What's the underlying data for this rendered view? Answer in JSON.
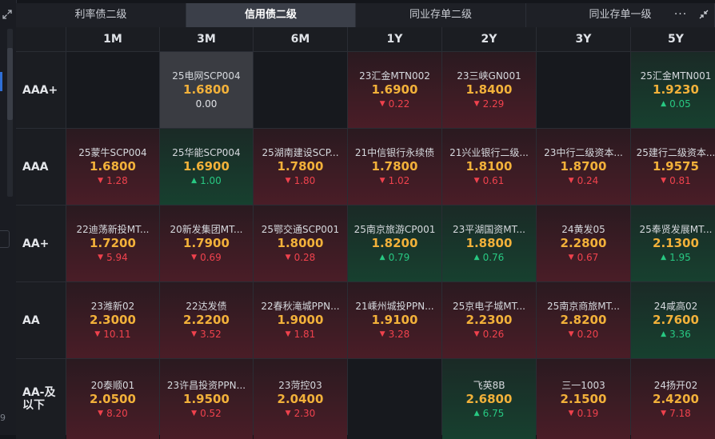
{
  "sidebar": {
    "bottom_number": "9"
  },
  "tabs": [
    {
      "label": "利率债二级",
      "active": false,
      "width": 213
    },
    {
      "label": "信用债二级",
      "active": true,
      "width": 212
    },
    {
      "label": "同业存单二级",
      "active": false,
      "width": 213
    },
    {
      "label": "同业存单一级",
      "active": false,
      "width": 236
    }
  ],
  "more_label": "···",
  "columns": [
    "1M",
    "3M",
    "6M",
    "1Y",
    "2Y",
    "3Y",
    "5Y"
  ],
  "rows": [
    {
      "label": "AAA+",
      "cells": [
        null,
        {
          "name": "25电网SCP004",
          "rate": "1.6800",
          "change": "0.00",
          "dir": "flat",
          "bg": "neutral"
        },
        null,
        {
          "name": "23汇金MTN002",
          "rate": "1.6900",
          "change": "0.22",
          "dir": "down",
          "bg": "red"
        },
        {
          "name": "23三峡GN001",
          "rate": "1.8400",
          "change": "2.29",
          "dir": "down",
          "bg": "red"
        },
        null,
        {
          "name": "25汇金MTN001",
          "rate": "1.9230",
          "change": "0.05",
          "dir": "up",
          "bg": "green"
        }
      ]
    },
    {
      "label": "AAA",
      "cells": [
        {
          "name": "25蒙牛SCP004",
          "rate": "1.6800",
          "change": "1.28",
          "dir": "down",
          "bg": "red"
        },
        {
          "name": "25华能SCP004",
          "rate": "1.6900",
          "change": "1.00",
          "dir": "up",
          "bg": "green"
        },
        {
          "name": "25湖南建设SCP...",
          "rate": "1.7800",
          "change": "1.80",
          "dir": "down",
          "bg": "red"
        },
        {
          "name": "21中信银行永续债",
          "rate": "1.7800",
          "change": "1.02",
          "dir": "down",
          "bg": "red"
        },
        {
          "name": "21兴业银行二级...",
          "rate": "1.8100",
          "change": "0.61",
          "dir": "down",
          "bg": "red"
        },
        {
          "name": "23中行二级资本...",
          "rate": "1.8700",
          "change": "0.24",
          "dir": "down",
          "bg": "red"
        },
        {
          "name": "25建行二级资本...",
          "rate": "1.9575",
          "change": "0.81",
          "dir": "down",
          "bg": "red"
        }
      ]
    },
    {
      "label": "AA+",
      "cells": [
        {
          "name": "22迪荡新投MT...",
          "rate": "1.7200",
          "change": "5.94",
          "dir": "down",
          "bg": "red"
        },
        {
          "name": "20新发集团MT...",
          "rate": "1.7900",
          "change": "0.69",
          "dir": "down",
          "bg": "red"
        },
        {
          "name": "25鄂交通SCP001",
          "rate": "1.8000",
          "change": "0.28",
          "dir": "down",
          "bg": "red"
        },
        {
          "name": "25南京旅游CP001",
          "rate": "1.8200",
          "change": "0.79",
          "dir": "up",
          "bg": "green"
        },
        {
          "name": "23平湖国资MT...",
          "rate": "1.8800",
          "change": "0.76",
          "dir": "up",
          "bg": "green"
        },
        {
          "name": "24黄发05",
          "rate": "2.2800",
          "change": "0.67",
          "dir": "down",
          "bg": "red"
        },
        {
          "name": "25奉贤发展MT...",
          "rate": "2.1300",
          "change": "1.95",
          "dir": "up",
          "bg": "green"
        }
      ]
    },
    {
      "label": "AA",
      "cells": [
        {
          "name": "23潍新02",
          "rate": "2.3000",
          "change": "10.11",
          "dir": "down",
          "bg": "red"
        },
        {
          "name": "22达发债",
          "rate": "2.2200",
          "change": "3.52",
          "dir": "down",
          "bg": "red"
        },
        {
          "name": "22春秋滝城PPN...",
          "rate": "1.9000",
          "change": "1.81",
          "dir": "down",
          "bg": "red"
        },
        {
          "name": "21嵊州城投PPN...",
          "rate": "1.9100",
          "change": "3.28",
          "dir": "down",
          "bg": "red"
        },
        {
          "name": "25京电子城MT...",
          "rate": "2.2300",
          "change": "0.26",
          "dir": "down",
          "bg": "red"
        },
        {
          "name": "25南京商旅MT...",
          "rate": "2.8200",
          "change": "0.20",
          "dir": "down",
          "bg": "red"
        },
        {
          "name": "24咸高02",
          "rate": "2.7600",
          "change": "3.36",
          "dir": "up",
          "bg": "green"
        }
      ]
    },
    {
      "label": "AA-及\n以下",
      "cells": [
        {
          "name": "20泰顺01",
          "rate": "2.0500",
          "change": "8.20",
          "dir": "down",
          "bg": "red"
        },
        {
          "name": "23许昌投资PPN...",
          "rate": "1.9500",
          "change": "0.52",
          "dir": "down",
          "bg": "red"
        },
        {
          "name": "23菏控03",
          "rate": "2.0400",
          "change": "2.30",
          "dir": "down",
          "bg": "red"
        },
        null,
        {
          "name": "飞英8B",
          "rate": "2.6800",
          "change": "6.75",
          "dir": "up",
          "bg": "green"
        },
        {
          "name": "三一1003",
          "rate": "2.1500",
          "change": "0.19",
          "dir": "down",
          "bg": "red"
        },
        {
          "name": "24扬开02",
          "rate": "2.4200",
          "change": "7.18",
          "dir": "down",
          "bg": "red"
        }
      ]
    }
  ],
  "colors": {
    "rate": "#f2b13a",
    "down": "#f0424d",
    "up": "#28c882",
    "active_tab": "#3b3f49"
  }
}
